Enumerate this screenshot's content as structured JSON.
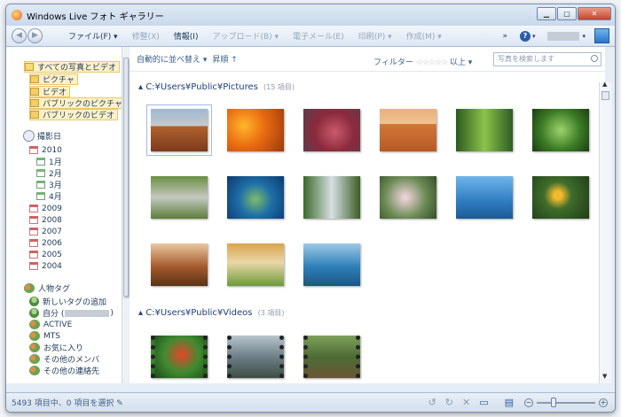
{
  "window": {
    "title": "Windows Live フォト ギャラリー"
  },
  "toolbar": {
    "back": "◀",
    "forward": "▶",
    "file": "ファイル(F) ▾",
    "fix": "修整(X)",
    "info": "情報(I)",
    "upload": "アップロード(B) ▾",
    "email": "電子メール(E)",
    "print": "印刷(P) ▾",
    "create": "作成(M) ▾",
    "more": "»",
    "help_icon": "?"
  },
  "left_pane": {
    "all_photos": "すべての写真とビデオ",
    "pictures": "ピクチャ",
    "videos": "ビデオ",
    "public_pictures": "パブリックのピクチャ",
    "public_videos": "パブリックのビデオ",
    "date_taken": "撮影日",
    "years": [
      "2010",
      "2009",
      "2008",
      "2007",
      "2006",
      "2005",
      "2004"
    ],
    "months": [
      "1月",
      "2月",
      "3月",
      "4月"
    ],
    "people_tags": "人物タグ",
    "add_tag": "新しいタグの追加",
    "me": "自分 (",
    "me_close": ")",
    "tags": [
      "ACTIVE",
      "MTS",
      "お気に入り",
      "その他のメンバ",
      "その他の連絡先"
    ]
  },
  "subbar": {
    "sort": "自動的に並べ替え ▾",
    "order": "昇順 ↑",
    "filter_label": "フィルター",
    "stars": "☆☆☆☆☆",
    "filter_suffix": "以上 ▾",
    "search_placeholder": "写真を検索します"
  },
  "groups": {
    "pictures_path": "▴ C:¥Users¥Public¥Pictures",
    "pictures_count": "(15 項目)",
    "videos_path": "▴ C:¥Users¥Public¥Videos",
    "videos_count": "(3 項目)"
  },
  "status": {
    "text": "5493 項目中、0 項目を選択 ✎",
    "zoom_out": "−",
    "zoom_in": "+"
  },
  "icons": {
    "rotate_left": "↺",
    "rotate_right": "↻",
    "delete": "✕",
    "slideshow": "▭",
    "view": "▤"
  }
}
